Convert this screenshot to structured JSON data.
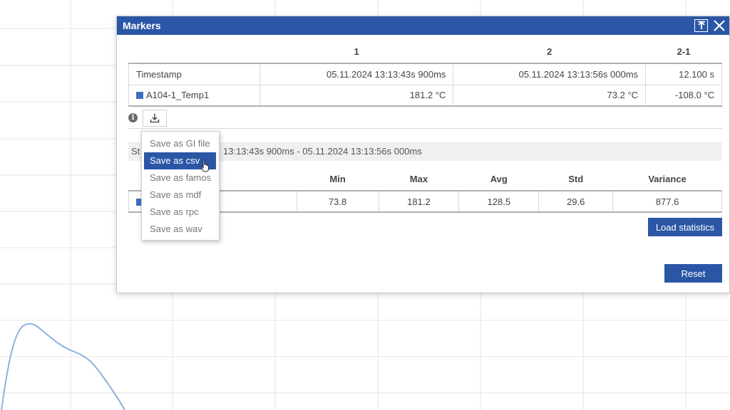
{
  "dialog": {
    "title": "Markers"
  },
  "markers_table": {
    "headers": [
      "",
      "1",
      "2",
      "2-1"
    ],
    "rows": [
      {
        "name": "Timestamp",
        "m1": "05.11.2024 13:13:43s 900ms",
        "m2": "05.11.2024 13:13:56s 000ms",
        "diff": "12.100 s"
      },
      {
        "name": "A104-1_Temp1",
        "m1": "181.2 °C",
        "m2": "73.2 °C",
        "diff": "-108.0 °C"
      }
    ]
  },
  "series_color": "#3f6fc0",
  "accent_color": "#2b56a6",
  "icons": {
    "info": "info-icon",
    "download": "download-icon",
    "detach": "detach-icon",
    "close": "close-icon"
  },
  "stats": {
    "label_visible": "St",
    "range": "13:13:43s 900ms - 05.11.2024 13:13:56s 000ms",
    "headers": [
      "",
      "Min",
      "Max",
      "Avg",
      "Std",
      "Variance"
    ],
    "row": {
      "min": "73.8",
      "max": "181.2",
      "avg": "128.5",
      "std": "29.6",
      "variance": "877.6"
    }
  },
  "buttons": {
    "load_statistics": "Load statistics",
    "reset": "Reset"
  },
  "save_menu": {
    "items": [
      "Save as GI file",
      "Save as csv",
      "Save as famos",
      "Save as mdf",
      "Save as rpc",
      "Save as wav"
    ],
    "selected_index": 1
  }
}
